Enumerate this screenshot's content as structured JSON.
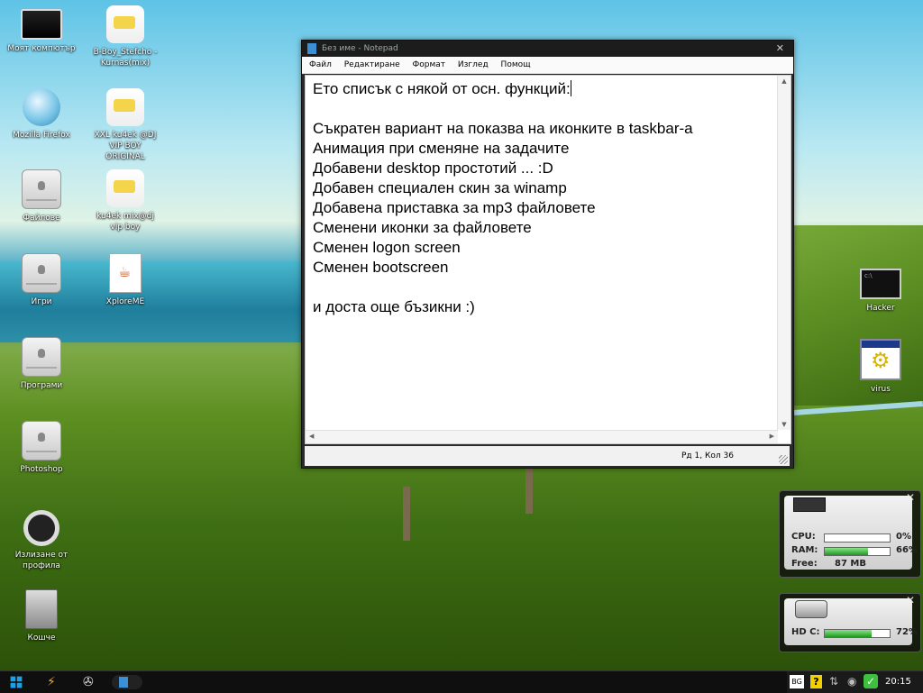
{
  "desktop_icons": [
    {
      "label": "Моят компютър"
    },
    {
      "label": "B-Boy_Stefcho - Kurnas(mix)"
    },
    {
      "label": "Mozilla Firefox"
    },
    {
      "label": "XXL ku4ek @DJ VIP BOY ORIGINAL"
    },
    {
      "label": "Файлове"
    },
    {
      "label": "ku4ek mix@dj vip boy"
    },
    {
      "label": "Игри"
    },
    {
      "label": "XploreME"
    },
    {
      "label": "Програми"
    },
    {
      "label": "Photoshop"
    },
    {
      "label": "Излизане от профила"
    },
    {
      "label": "Кошче"
    },
    {
      "label": "Hacker"
    },
    {
      "label": "virus"
    }
  ],
  "notepad": {
    "title": "Без име - Notepad",
    "close_glyph": "✕",
    "menu": [
      "Файл",
      "Редактиране",
      "Формат",
      "Изглед",
      "Помощ"
    ],
    "lines": [
      "Ето списък с някой от осн. функций:",
      "",
      "Съкратен вариант на показва на иконките в taskbar-a",
      "Анимация при сменяне на задачите",
      "Добавени desktop простотий ... :D",
      "Добавен специален скин за winamp",
      "Добавена приставка за mp3 файловете",
      "Сменени иконки за файловете",
      "Сменен logon screen",
      "Сменен bootscreen",
      "",
      "и доста още бъзикни :)"
    ],
    "status": "Рд 1, Кол 36"
  },
  "cpu_gadget": {
    "cpu_label": "CPU:",
    "cpu_pct": "0%",
    "cpu_value": 0,
    "ram_label": "RAM:",
    "ram_pct": "66%",
    "ram_value": 0.66,
    "free_label": "Free:",
    "free_value": "87 MB"
  },
  "hdd_gadget": {
    "drive_label": "HD C:",
    "drive_pct": "72%",
    "drive_value": 0.72
  },
  "taskbar": {
    "lang": "BG",
    "help": "?",
    "clock": "20:15"
  },
  "colors": {
    "accent": "#1ea0e6",
    "meter_green": "#1c9b1c"
  }
}
